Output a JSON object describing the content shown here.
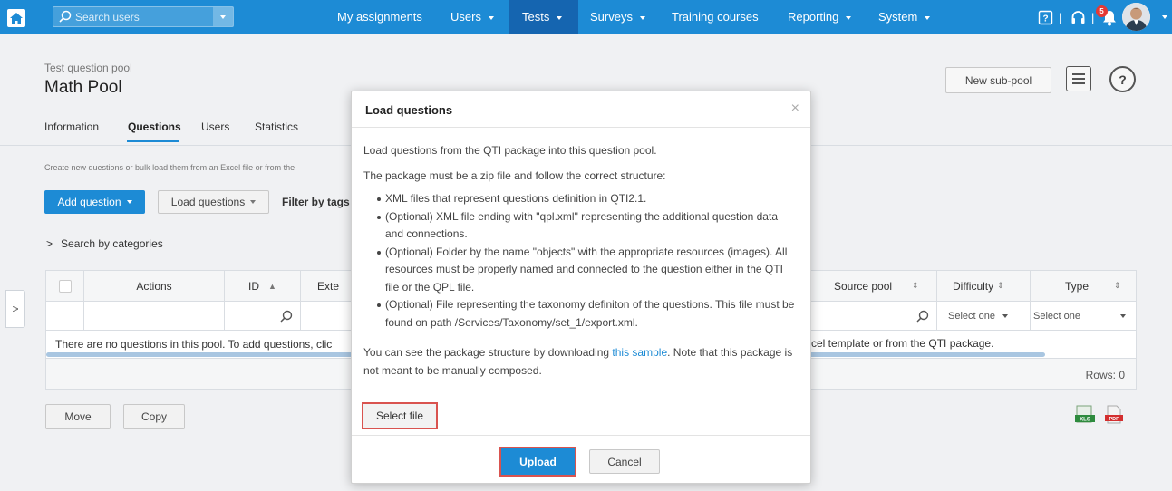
{
  "navbar": {
    "search_placeholder": "Search users",
    "items": [
      {
        "label": "My assignments"
      },
      {
        "label": "Users"
      },
      {
        "label": "Tests"
      },
      {
        "label": "Surveys"
      },
      {
        "label": "Training courses"
      },
      {
        "label": "Reporting"
      },
      {
        "label": "System"
      }
    ],
    "notification_count": "5",
    "separator": "|"
  },
  "page": {
    "subtitle": "Test question pool",
    "title": "Math Pool",
    "new_subpool_label": "New sub-pool",
    "tabs": [
      {
        "label": "Information"
      },
      {
        "label": "Questions"
      },
      {
        "label": "Users"
      },
      {
        "label": "Statistics"
      }
    ],
    "hint": "Create new questions or bulk load them from an Excel file or from the",
    "add_question_label": "Add question",
    "load_questions_label": "Load questions",
    "filter_by_tags_label": "Filter by tags",
    "search_by_categories_label": "Search by categories"
  },
  "grid": {
    "columns": [
      {
        "label": "Actions"
      },
      {
        "label": "ID"
      },
      {
        "label": "Exte"
      },
      {
        "label": "Source pool"
      },
      {
        "label": "Difficulty"
      },
      {
        "label": "Type"
      }
    ],
    "difficulty_filter_value": "Select one",
    "type_filter_value": "Select one",
    "empty_text": "There are no questions in this pool. To add questions, clic",
    "empty_text_tail": "cel template or from the QTI package.",
    "rows_label": "Rows: 0"
  },
  "actions": {
    "move_label": "Move",
    "copy_label": "Copy"
  },
  "modal": {
    "title": "Load questions",
    "close_glyph": "×",
    "intro": "Load questions from the QTI package into this question pool.",
    "structure": "The package must be a zip file and follow the correct structure:",
    "bullets": [
      "XML files that represent questions definition in QTI2.1.",
      "(Optional) XML file ending with \"qpl.xml\" representing the additional question data and connections.",
      "(Optional) Folder by the name \"objects\" with the appropriate resources (images). All resources must be properly named and connected to the question either in the QTI file or the QPL file.",
      "(Optional) File representing the taxonomy definiton of the questions. This file must be found on path /Services/Taxonomy/set_1/export.xml."
    ],
    "sample_prefix": "You can see the package structure by downloading ",
    "sample_link": "this sample",
    "sample_suffix": ". Note that this package is not meant to be manually composed.",
    "select_file_label": "Select file",
    "upload_label": "Upload",
    "cancel_label": "Cancel"
  },
  "colors": {
    "brand": "#1d8bd5",
    "highlight": "#d9534f"
  }
}
